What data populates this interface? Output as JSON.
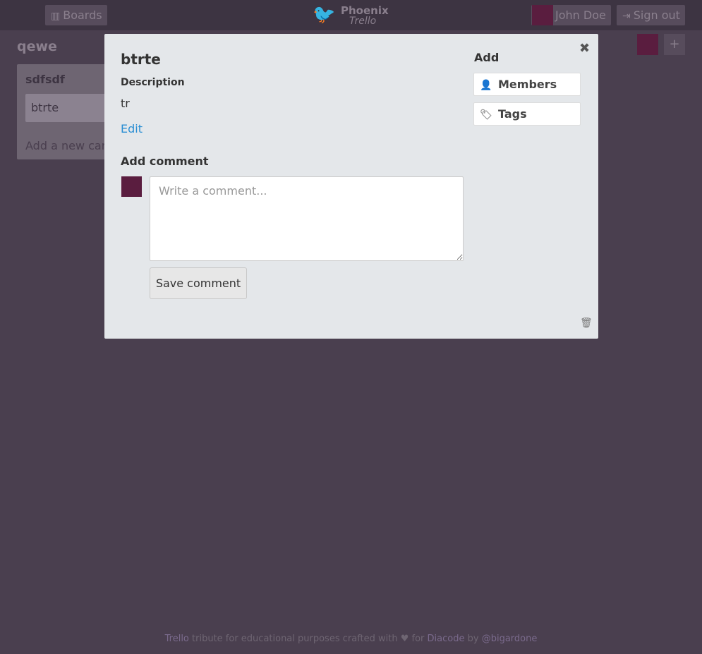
{
  "header": {
    "boards_label": "Boards",
    "logo_line1": "Phoenix",
    "logo_line2": "Trello",
    "user_name": "John Doe",
    "signout_label": "Sign out"
  },
  "board": {
    "title": "qewe",
    "add_button": "+",
    "lists": [
      {
        "title": "sdfsdf",
        "cards": [
          "btrte"
        ],
        "add_card_label": "Add a new card..."
      }
    ]
  },
  "modal": {
    "card_title": "btrte",
    "description_label": "Description",
    "description_text": "tr",
    "edit_label": "Edit",
    "add_comment_heading": "Add comment",
    "comment_placeholder": "Write a comment...",
    "save_comment_label": "Save comment",
    "add_heading": "Add",
    "members_label": "Members",
    "tags_label": "Tags"
  },
  "footer": {
    "brand": "Trello",
    "text1": " tribute for educational purposes crafted with ♥ for ",
    "company": "Diacode",
    "text2": " by ",
    "author": "@bigardone"
  },
  "colors": {
    "background": "#4a3f4f",
    "modal_bg": "#e4e7ea",
    "link": "#2b8fd3",
    "avatar": "#5a1d3f"
  }
}
